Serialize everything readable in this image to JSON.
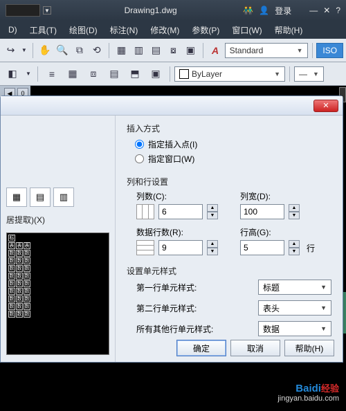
{
  "titlebar": {
    "filename": "Drawing1.dwg",
    "login": "登录",
    "search_icon": "🔍",
    "person_icon": "👤",
    "x_icon": "✕"
  },
  "menus": [
    "D)",
    "工具(T)",
    "绘图(D)",
    "标注(N)",
    "修改(M)",
    "参数(P)",
    "窗口(W)",
    "帮助(H)"
  ],
  "toolbar2": {
    "style_label": "Standard",
    "layer_label": "ByLayer",
    "iso_label": "ISO"
  },
  "tabbar": {
    "zero": "0"
  },
  "dialog": {
    "insert_group": {
      "title": "插入方式",
      "opt1": "指定插入点(I)",
      "opt2": "指定窗口(W)",
      "selected": "opt1"
    },
    "rowcol_group": {
      "title": "列和行设置",
      "cols_label": "列数(C):",
      "cols_value": "6",
      "width_label": "列宽(D):",
      "width_value": "100",
      "datarows_label": "数据行数(R):",
      "datarows_value": "9",
      "rowheight_label": "行高(G):",
      "rowheight_value": "5",
      "rowheight_unit": "行"
    },
    "styles_group": {
      "title": "设置单元样式",
      "row1_label": "第一行单元样式:",
      "row1_value": "标题",
      "row2_label": "第二行单元样式:",
      "row2_value": "表头",
      "rest_label": "所有其他行单元样式:",
      "rest_value": "数据"
    },
    "leftcol": {
      "extract_label": "居提取)(X)"
    },
    "buttons": {
      "ok": "确定",
      "cancel": "取消",
      "help": "帮助(H)"
    }
  },
  "watermark": {
    "brand_a": "Bai",
    "brand_b": "di",
    "brand_c": "经验",
    "url": "jingyan.baidu.com"
  }
}
